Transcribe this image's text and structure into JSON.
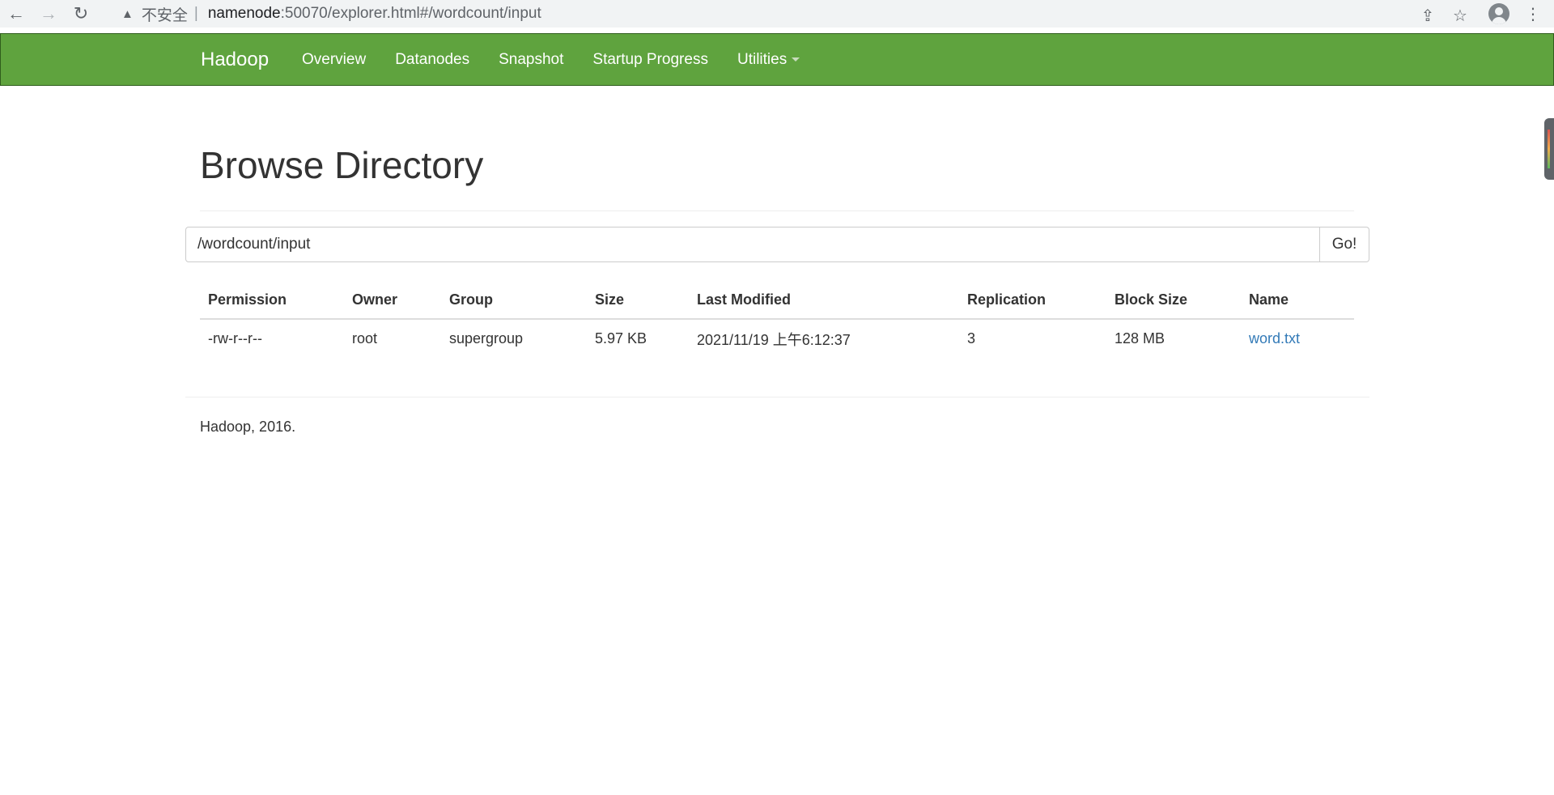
{
  "browser": {
    "back_icon": "←",
    "forward_icon": "→",
    "reload_icon": "↻",
    "warning_icon": "▲",
    "insecure_label": "不安全",
    "separator": "|",
    "url_host": "namenode",
    "url_path": ":50070/explorer.html#/wordcount/input",
    "share_icon": "⇪",
    "star_icon": "☆",
    "menu_icon": "⋮"
  },
  "navbar": {
    "brand": "Hadoop",
    "items": [
      {
        "label": "Overview"
      },
      {
        "label": "Datanodes"
      },
      {
        "label": "Snapshot"
      },
      {
        "label": "Startup Progress"
      },
      {
        "label": "Utilities"
      }
    ]
  },
  "main": {
    "title": "Browse Directory",
    "path_value": "/wordcount/input",
    "go_label": "Go!",
    "table": {
      "headers": [
        "Permission",
        "Owner",
        "Group",
        "Size",
        "Last Modified",
        "Replication",
        "Block Size",
        "Name"
      ],
      "rows": [
        [
          "-rw-r--r--",
          "root",
          "supergroup",
          "5.97 KB",
          "2021/11/19 上午6:12:37",
          "3",
          "128 MB",
          "word.txt"
        ]
      ]
    },
    "footer": "Hadoop, 2016."
  },
  "colors": {
    "navbar_bg": "#5fa33e",
    "link": "#337ab7"
  }
}
